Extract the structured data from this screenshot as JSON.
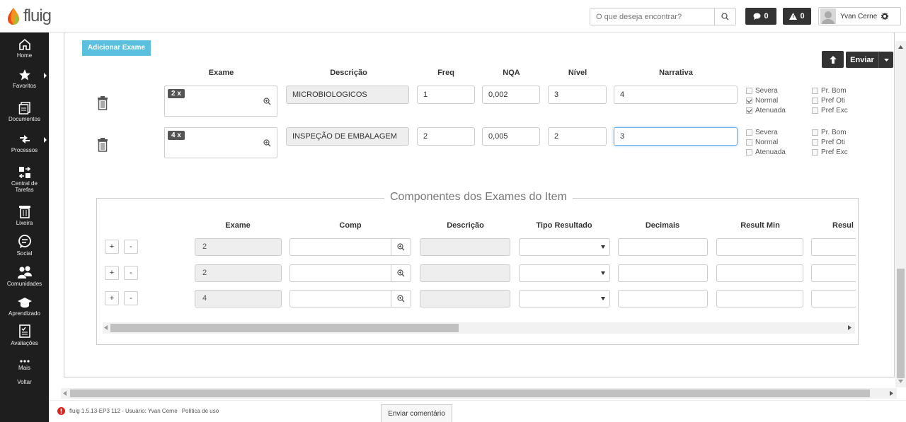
{
  "app": {
    "logo_text": "fluig"
  },
  "search": {
    "placeholder": "O que deseja encontrar?"
  },
  "badges": {
    "messages": "0",
    "alerts": "0"
  },
  "user": {
    "name": "Yvan Cerne"
  },
  "sidebar": {
    "items": [
      {
        "label": "Home",
        "icon": "home-icon"
      },
      {
        "label": "Favoritos",
        "icon": "star-icon"
      },
      {
        "label": "Documentos",
        "icon": "documents-icon"
      },
      {
        "label": "Processos",
        "icon": "processes-icon"
      },
      {
        "label": "Central de Tarefas",
        "icon": "tasks-icon"
      },
      {
        "label": "Lixeira",
        "icon": "trash-icon"
      },
      {
        "label": "Social",
        "icon": "social-icon"
      },
      {
        "label": "Comunidades",
        "icon": "communities-icon"
      },
      {
        "label": "Aprendizado",
        "icon": "learning-icon"
      },
      {
        "label": "Avaliações",
        "icon": "evaluations-icon"
      },
      {
        "label": "Mais",
        "icon": "more-icon"
      },
      {
        "label": "Voltar",
        "icon": ""
      }
    ]
  },
  "toolbar": {
    "add_exam": "Adicionar Exame",
    "send": "Enviar"
  },
  "exam_table": {
    "headers": {
      "exame": "Exame",
      "descricao": "Descrição",
      "freq": "Freq",
      "nqa": "NQA",
      "nivel": "Nível",
      "narrativa": "Narrativa"
    },
    "rows": [
      {
        "tag": "2 x",
        "descricao": "MICROBIOLOGICOS",
        "freq": "1",
        "nqa": "0,002",
        "nivel": "3",
        "narrativa": "4",
        "checks": [
          {
            "label": "Severa",
            "checked": false
          },
          {
            "label": "Normal",
            "checked": true
          },
          {
            "label": "Atenuada",
            "checked": true
          }
        ],
        "prefs": [
          {
            "label": "Pr. Bom",
            "checked": false
          },
          {
            "label": "Pref Oti",
            "checked": false
          },
          {
            "label": "Pref Exc",
            "checked": false
          }
        ]
      },
      {
        "tag": "4 x",
        "descricao": "INSPEÇÃO DE EMBALAGEM",
        "freq": "2",
        "nqa": "0,005",
        "nivel": "2",
        "narrativa": "3",
        "checks": [
          {
            "label": "Severa",
            "checked": false
          },
          {
            "label": "Normal",
            "checked": false
          },
          {
            "label": "Atenuada",
            "checked": false
          }
        ],
        "prefs": [
          {
            "label": "Pr. Bom",
            "checked": false
          },
          {
            "label": "Pref Oti",
            "checked": false
          },
          {
            "label": "Pref Exc",
            "checked": false
          }
        ]
      }
    ]
  },
  "components": {
    "legend": "Componentes dos Exames do Item",
    "headers": {
      "exame": "Exame",
      "comp": "Comp",
      "descricao": "Descrição",
      "tipo": "Tipo Resultado",
      "decimais": "Decimais",
      "min": "Result Min",
      "max": "Resul"
    },
    "plus": "+",
    "minus": "-",
    "rows": [
      {
        "exame": "2"
      },
      {
        "exame": "2"
      },
      {
        "exame": "4"
      }
    ]
  },
  "footer": {
    "version": "fluig 1.5.13-EP3 112 - Usuário: Yvan Cerne",
    "policy": "Política de uso",
    "comment": "Enviar comentário"
  }
}
